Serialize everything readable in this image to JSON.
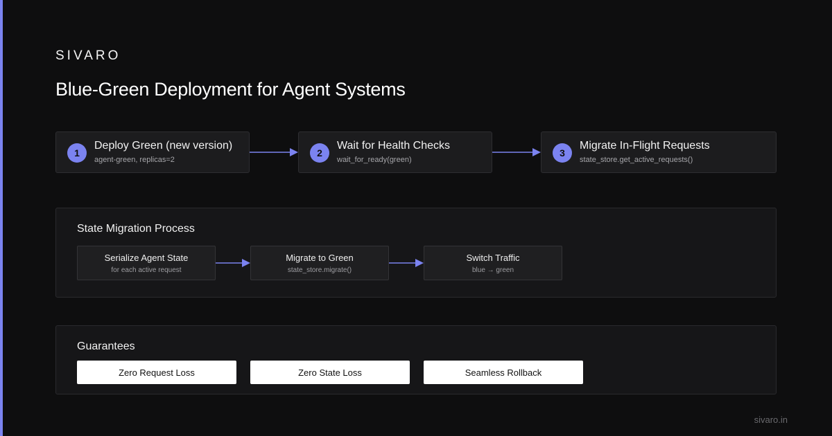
{
  "brand": "SIVARO",
  "title": "Blue-Green Deployment for Agent Systems",
  "steps": [
    {
      "number": "1",
      "title": "Deploy Green (new version)",
      "subtitle": "agent-green, replicas=2"
    },
    {
      "number": "2",
      "title": "Wait for Health Checks",
      "subtitle": "wait_for_ready(green)"
    },
    {
      "number": "3",
      "title": "Migrate In-Flight Requests",
      "subtitle": "state_store.get_active_requests()"
    }
  ],
  "migration": {
    "title": "State Migration Process",
    "boxes": [
      {
        "title": "Serialize Agent State",
        "subtitle": "for each active request"
      },
      {
        "title": "Migrate to Green",
        "subtitle": "state_store.migrate()"
      },
      {
        "title": "Switch Traffic",
        "subtitle": "blue → green"
      }
    ]
  },
  "guarantees": {
    "title": "Guarantees",
    "items": [
      "Zero Request Loss",
      "Zero State Loss",
      "Seamless Rollback"
    ]
  },
  "footer": "sivaro.in",
  "colors": {
    "accent": "#7b83f0",
    "background": "#0e0e0f",
    "card": "#1c1c1e"
  }
}
